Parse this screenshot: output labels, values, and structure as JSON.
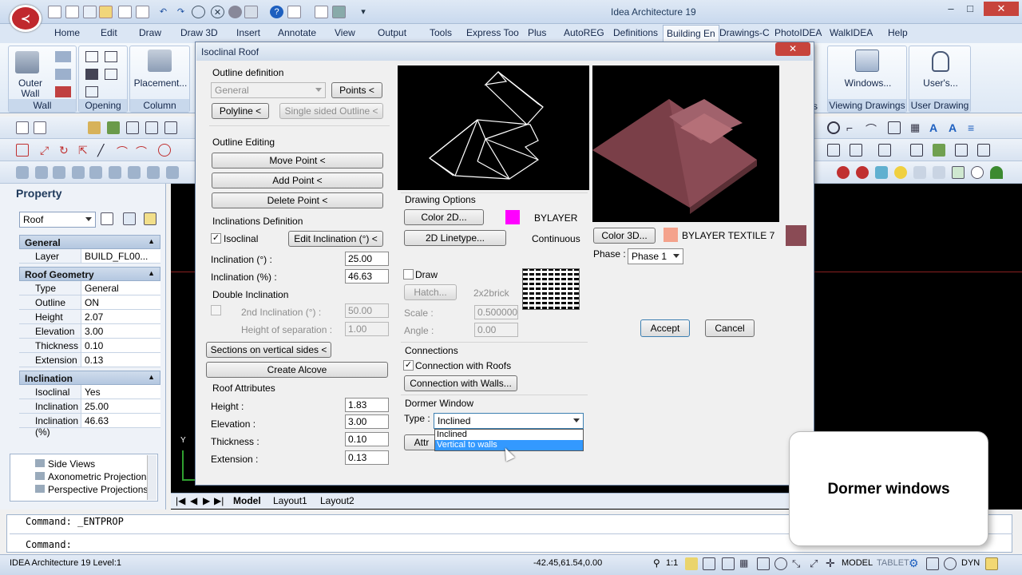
{
  "window": {
    "title": "Idea Architecture 19",
    "logo_text": "≺"
  },
  "ribbon_tabs": [
    "Home",
    "Edit",
    "Draw",
    "Draw 3D",
    "Insert",
    "Annotate",
    "View",
    "Output",
    "Tools",
    "Express Too",
    "Plus",
    "AutoREG",
    "Definitions",
    "Building En",
    "Drawings-C",
    "PhotoIDEA",
    "WalkIDEA",
    "Help"
  ],
  "ribbon_groups": {
    "wall": {
      "label": "Wall",
      "button": "Outer\nWall"
    },
    "opening": {
      "label": "Opening"
    },
    "column": {
      "label": "Column",
      "button": "Placement..."
    },
    "viewing": {
      "label": "Viewing Drawings",
      "button": "Windows..."
    },
    "user": {
      "label": "User Drawing",
      "button": "User's..."
    },
    "cut_label": "s"
  },
  "property": {
    "title": "Property",
    "selector": "Roof",
    "sections": [
      {
        "name": "General",
        "rows": [
          [
            "Layer",
            "BUILD_FL00..."
          ]
        ]
      },
      {
        "name": "Roof Geometry",
        "rows": [
          [
            "Type",
            "General"
          ],
          [
            "Outline",
            "ON"
          ],
          [
            "Height",
            "2.07"
          ],
          [
            "Elevation",
            "3.00"
          ],
          [
            "Thickness",
            "0.10"
          ],
          [
            "Extension",
            "0.13"
          ]
        ]
      },
      {
        "name": "Inclination",
        "rows": [
          [
            "Isoclinal",
            "Yes"
          ],
          [
            "Inclination (°)",
            "25.00"
          ],
          [
            "Inclination (%)",
            "46.63"
          ]
        ]
      }
    ]
  },
  "tree": [
    "Side Views",
    "Axonometric Projections",
    "Perspective Projections"
  ],
  "layout_tabs": [
    "Model",
    "Layout1",
    "Layout2"
  ],
  "command": {
    "line1": "Command: _ENTPROP",
    "line2": "Command:"
  },
  "status": {
    "left": "IDEA Architecture 19 Level:1",
    "coords": "-42.45,61.54,0.00",
    "scale": "1:1",
    "model": "MODEL",
    "tablet": "TABLET",
    "dyn": "DYN"
  },
  "dialog": {
    "title": "Isoclinal Roof",
    "close": "✕",
    "outline_definition": {
      "label": "Outline definition",
      "select": "General",
      "points_btn": "Points <",
      "polyline_btn": "Polyline <",
      "single_btn": "Single sided Outline <"
    },
    "outline_editing": {
      "label": "Outline Editing",
      "move_btn": "Move Point <",
      "add_btn": "Add Point <",
      "delete_btn": "Delete Point <"
    },
    "inclinations": {
      "label": "Inclinations Definition",
      "isoclinal": "Isoclinal",
      "isoclinal_checked": "✓",
      "edit_btn": "Edit Inclination (°) <",
      "incl_deg_label": "Inclination (°) :",
      "incl_deg": "25.00",
      "incl_pct_label": "Inclination (%) :",
      "incl_pct": "46.63"
    },
    "double_inclination": {
      "label": "Double Inclination",
      "second_label": "2nd Inclination (°) :",
      "second": "50.00",
      "sep_label": "Height of separation :",
      "sep": "1.00"
    },
    "sections_btn": "Sections on vertical sides <",
    "alcove_btn": "Create Alcove",
    "roof_attributes": {
      "label": "Roof Attributes",
      "height_label": "Height :",
      "height": "1.83",
      "elevation_label": "Elevation :",
      "elevation": "3.00",
      "thickness_label": "Thickness :",
      "thickness": "0.10",
      "extension_label": "Extension :",
      "extension": "0.13"
    },
    "drawing_options": {
      "label": "Drawing Options",
      "color2d_btn": "Color 2D...",
      "color2d_name": "BYLAYER",
      "color2d": "#ff00ff",
      "linetype_btn": "2D Linetype...",
      "linetype_name": "Continuous",
      "draw": "Draw",
      "hatch_btn": "Hatch...",
      "hatch_name": "2x2brick",
      "scale_label": "Scale :",
      "scale": "0.500000",
      "angle_label": "Angle :",
      "angle": "0.00"
    },
    "color3d": {
      "btn": "Color 3D...",
      "name": "BYLAYER TEXTILE 7",
      "swatch": "#f4a28c",
      "material": "#8a4b55"
    },
    "phase": {
      "label": "Phase :",
      "value": "Phase 1"
    },
    "accept_btn": "Accept",
    "cancel_btn": "Cancel",
    "connections": {
      "label": "Connections",
      "roofs": "Connection with Roofs",
      "roofs_checked": "✓",
      "walls_btn": "Connection with Walls..."
    },
    "dormer": {
      "label": "Dormer Window",
      "type_label": "Type :",
      "type_value": "Inclined",
      "attr_btn": "Attr",
      "options": [
        "Inclined",
        "Vertical to walls"
      ]
    }
  },
  "callout": "Dormer windows"
}
